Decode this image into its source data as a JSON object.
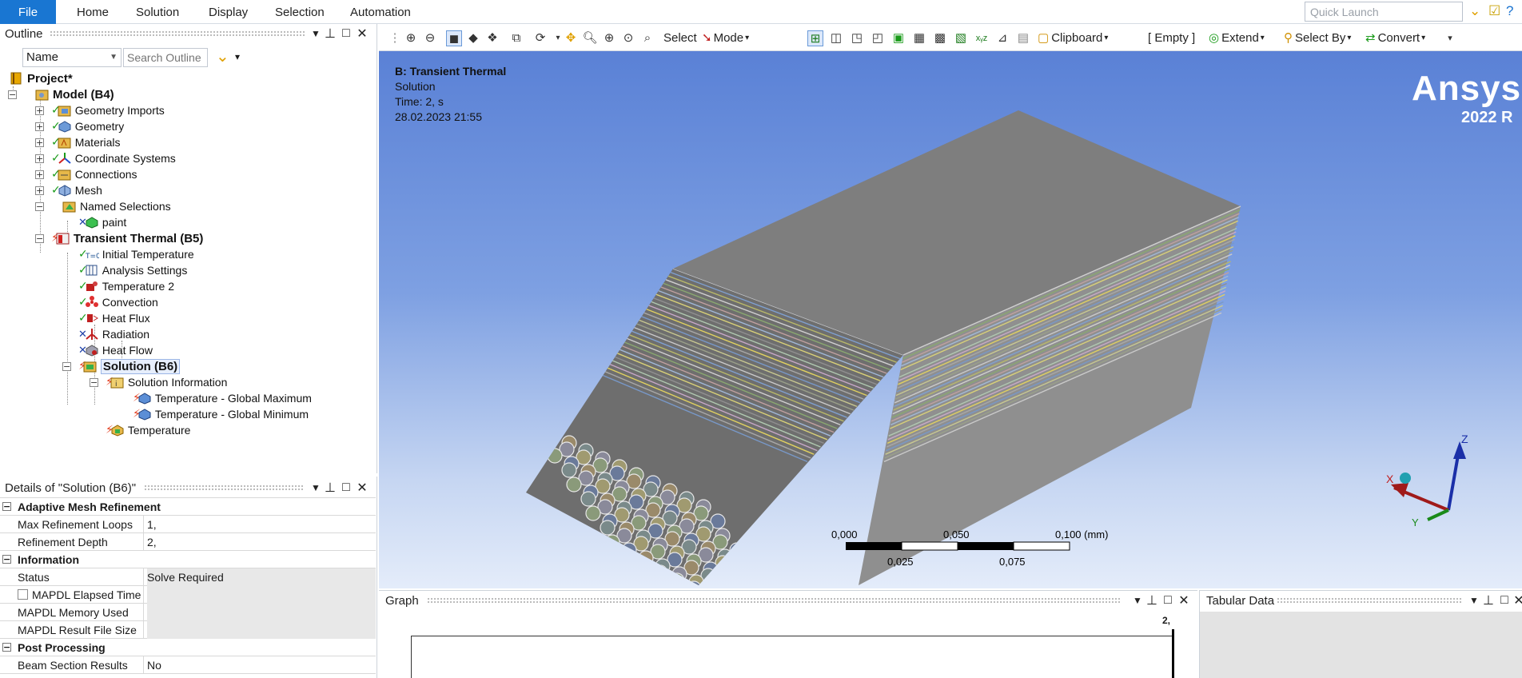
{
  "ribbon": {
    "file_label": "File",
    "tabs": [
      "Home",
      "Solution",
      "Display",
      "Selection",
      "Automation"
    ],
    "quick_launch_placeholder": "Quick Launch"
  },
  "outline": {
    "title": "Outline",
    "filter_select": "Name",
    "search_placeholder": "Search Outline",
    "tree": {
      "project": "Project*",
      "model": "Model (B4)",
      "geometry_imports": "Geometry Imports",
      "geometry": "Geometry",
      "materials": "Materials",
      "coordinate_systems": "Coordinate Systems",
      "connections": "Connections",
      "mesh": "Mesh",
      "named_selections": "Named Selections",
      "paint": "paint",
      "transient_thermal": "Transient Thermal (B5)",
      "initial_temperature": "Initial Temperature",
      "analysis_settings": "Analysis Settings",
      "temperature_2": "Temperature 2",
      "convection": "Convection",
      "heat_flux": "Heat Flux",
      "radiation": "Radiation",
      "heat_flow": "Heat Flow",
      "solution": "Solution (B6)",
      "solution_information": "Solution Information",
      "temp_global_max": "Temperature - Global Maximum",
      "temp_global_min": "Temperature - Global Minimum",
      "temperature": "Temperature"
    }
  },
  "details": {
    "title": "Details of \"Solution (B6)\"",
    "group_adaptive": "Adaptive Mesh Refinement",
    "max_refinement_loops_label": "Max Refinement Loops",
    "max_refinement_loops_value": "1,",
    "refinement_depth_label": "Refinement Depth",
    "refinement_depth_value": "2,",
    "group_information": "Information",
    "status_label": "Status",
    "status_value": "Solve Required",
    "mapdl_elapsed_label": "MAPDL Elapsed Time",
    "mapdl_memory_label": "MAPDL Memory Used",
    "mapdl_result_label": "MAPDL Result File Size",
    "group_post": "Post Processing",
    "beam_section_label": "Beam Section Results",
    "beam_section_value": "No"
  },
  "toolbar": {
    "select_label": "Select",
    "mode_label": "Mode",
    "clipboard_label": "Clipboard",
    "empty_label": "[ Empty ]",
    "extend_label": "Extend",
    "select_by_label": "Select By",
    "convert_label": "Convert"
  },
  "viewport": {
    "analysis_title": "B: Transient Thermal",
    "result_name": "Solution",
    "time": "Time: 2, s",
    "date": "28.02.2023 21:55",
    "logo_text": "Ansys",
    "version_text": "2022 R",
    "scale_labels_top": [
      "0,000",
      "0,050",
      "0,100 (mm)"
    ],
    "scale_labels_bottom": [
      "0,025",
      "0,075"
    ],
    "triad": {
      "x": "X",
      "y": "Y",
      "z": "Z"
    }
  },
  "graph": {
    "title": "Graph",
    "axis_value": "2,"
  },
  "tabular": {
    "title": "Tabular Data"
  }
}
